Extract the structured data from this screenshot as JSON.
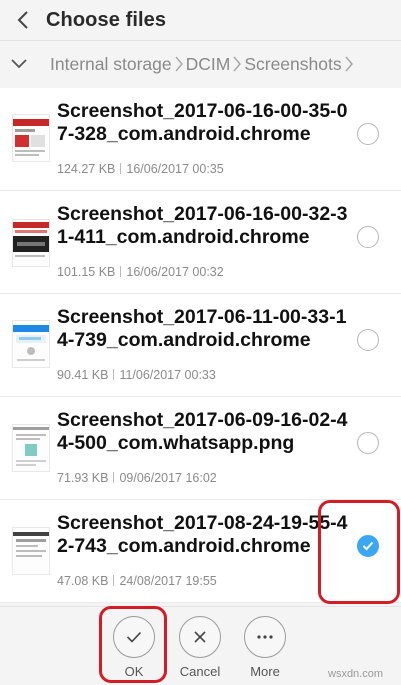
{
  "header": {
    "title": "Choose files",
    "back_icon": "chevron-left-icon"
  },
  "breadcrumb": {
    "toggle_icon": "chevron-down-icon",
    "segments": [
      "Internal storage",
      "DCIM",
      "Screenshots"
    ]
  },
  "files": [
    {
      "name": "Screenshot_2017-06-16-00-35-07-328_com.android.chrome",
      "size": "124.27 KB",
      "date": "16/06/2017 00:35",
      "selected": false
    },
    {
      "name": "Screenshot_2017-06-16-00-32-31-411_com.android.chrome",
      "size": "101.15 KB",
      "date": "16/06/2017 00:32",
      "selected": false
    },
    {
      "name": "Screenshot_2017-06-11-00-33-14-739_com.android.chrome",
      "size": "90.41 KB",
      "date": "11/06/2017 00:33",
      "selected": false
    },
    {
      "name": "Screenshot_2017-06-09-16-02-44-500_com.whatsapp.png",
      "size": "71.93 KB",
      "date": "09/06/2017 16:02",
      "selected": false
    },
    {
      "name": "Screenshot_2017-08-24-19-55-42-743_com.android.chrome",
      "size": "47.08 KB",
      "date": "24/08/2017 19:55",
      "selected": true
    }
  ],
  "actions": {
    "ok": "OK",
    "cancel": "Cancel",
    "more": "More"
  },
  "colors": {
    "accent": "#3aa7f2",
    "highlight": "#d21d26"
  },
  "watermark": "wsxdn.com"
}
